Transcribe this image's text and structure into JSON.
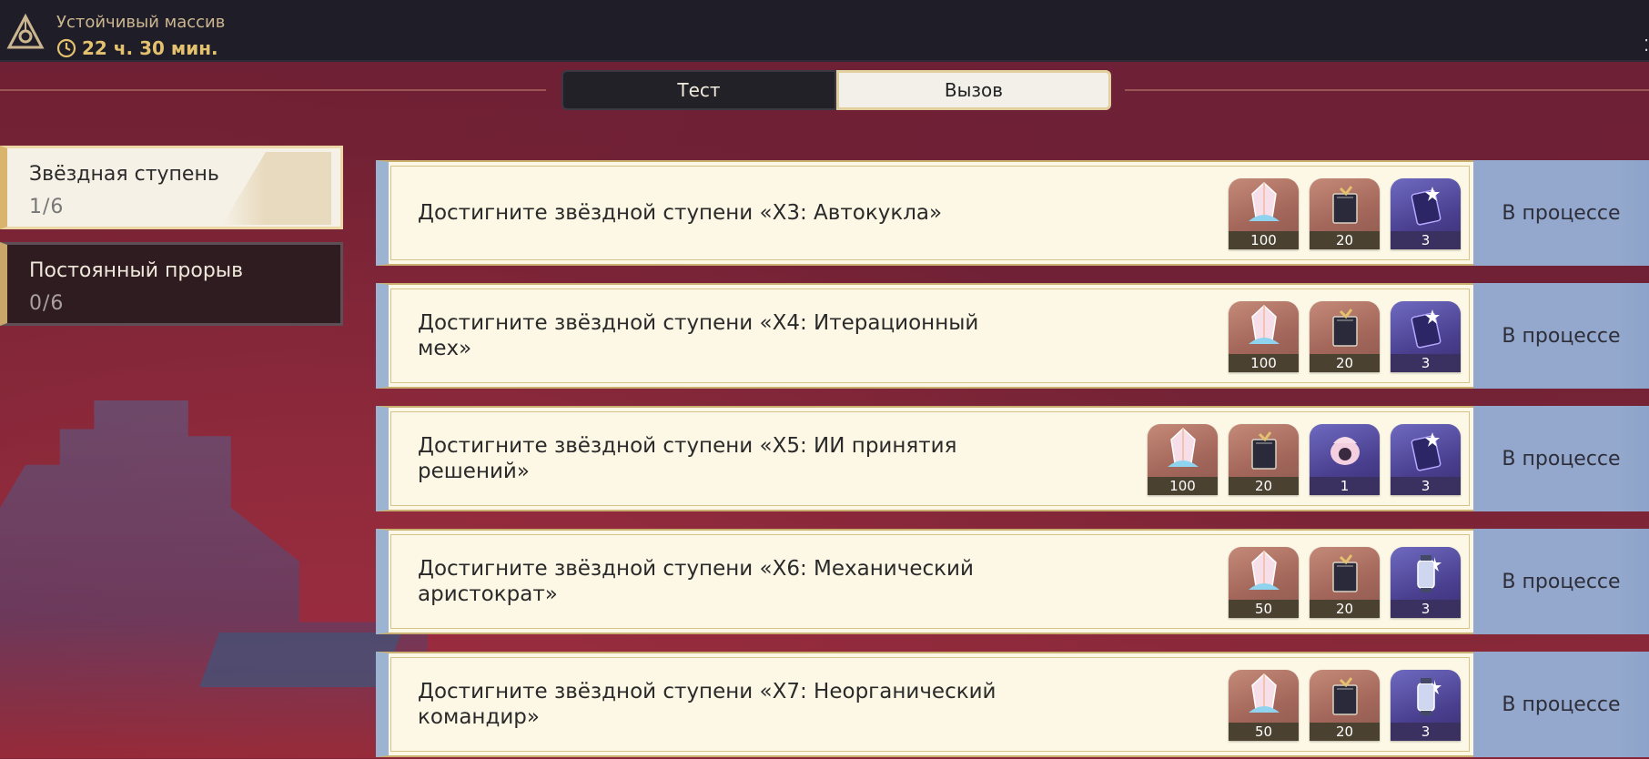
{
  "header": {
    "title": "Устойчивый массив",
    "timer": "22 ч. 30 мин."
  },
  "tabs": [
    {
      "label": "Тест",
      "active": false
    },
    {
      "label": "Вызов",
      "active": true
    }
  ],
  "sidebar": {
    "items": [
      {
        "label": "Звёздная ступень",
        "progress": "1/6",
        "active": true
      },
      {
        "label": "Постоянный прорыв",
        "progress": "0/6",
        "active": false
      }
    ]
  },
  "tasks": [
    {
      "text": "Достигните звёздной ступени «X3: Автокукла»",
      "status": "В процессе",
      "rewards": [
        {
          "icon": "crystal-icon",
          "qty": "100"
        },
        {
          "icon": "book-icon",
          "qty": "20"
        },
        {
          "icon": "star-card-icon",
          "qty": "3"
        }
      ]
    },
    {
      "text": "Достигните звёздной ступени «X4: Итерационный мех»",
      "status": "В процессе",
      "rewards": [
        {
          "icon": "crystal-icon",
          "qty": "100"
        },
        {
          "icon": "book-icon",
          "qty": "20"
        },
        {
          "icon": "star-card-icon",
          "qty": "3"
        }
      ]
    },
    {
      "text": "Достигните звёздной ступени «X5: ИИ принятия решений»",
      "status": "В процессе",
      "rewards": [
        {
          "icon": "crystal-icon",
          "qty": "100"
        },
        {
          "icon": "book-icon",
          "qty": "20"
        },
        {
          "icon": "pink-orb-icon",
          "qty": "1"
        },
        {
          "icon": "star-card-icon",
          "qty": "3"
        }
      ]
    },
    {
      "text": "Достигните звёздной ступени «X6: Механический аристократ»",
      "status": "В процессе",
      "rewards": [
        {
          "icon": "crystal-icon",
          "qty": "50"
        },
        {
          "icon": "book-icon",
          "qty": "20"
        },
        {
          "icon": "lantern-icon",
          "qty": "3"
        }
      ]
    },
    {
      "text": "Достигните звёздной ступени «X7: Неорганический командир»",
      "status": "В процессе",
      "rewards": [
        {
          "icon": "crystal-icon",
          "qty": "50"
        },
        {
          "icon": "book-icon",
          "qty": "20"
        },
        {
          "icon": "lantern-icon",
          "qty": "3"
        }
      ]
    }
  ],
  "colors": {
    "topbar": "#1f1e28",
    "title": "#cbb690",
    "timer": "#e3c16e",
    "task_bg": "#fdf8e6",
    "status_bg": "#93a8cc",
    "bg": "#7a2435"
  }
}
